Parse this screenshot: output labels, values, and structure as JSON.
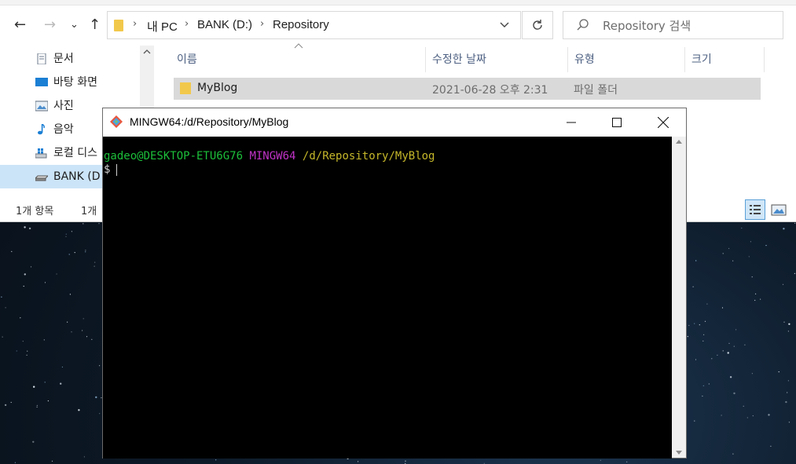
{
  "explorer": {
    "nav": {
      "back": "←",
      "forward": "→",
      "recent": "⌄",
      "up": "↑"
    },
    "breadcrumbs": [
      "내 PC",
      "BANK (D:)",
      "Repository"
    ],
    "search_placeholder": "Repository 검색",
    "sidebar": {
      "items": [
        {
          "label": "문서",
          "icon": "documents-icon"
        },
        {
          "label": "바탕 화면",
          "icon": "desktop-icon"
        },
        {
          "label": "사진",
          "icon": "pictures-icon"
        },
        {
          "label": "음악",
          "icon": "music-icon"
        },
        {
          "label": "로컬 디스",
          "icon": "local-disk-icon"
        },
        {
          "label": "BANK (D",
          "icon": "drive-icon"
        }
      ]
    },
    "columns": [
      "이름",
      "수정한 날짜",
      "유형",
      "크기"
    ],
    "files": [
      {
        "name": "MyBlog",
        "modified": "2021-06-28 오후 2:31",
        "type": "파일 폴더",
        "size": ""
      }
    ],
    "status": {
      "count": "1개 항목",
      "selected": "1개"
    }
  },
  "terminal": {
    "title": "MINGW64:/d/Repository/MyBlog",
    "prompt_user": "gadeo@DESKTOP-ETU6G76",
    "prompt_system": "MINGW64",
    "prompt_path": "/d/Repository/MyBlog",
    "prompt_symbol": "$",
    "colors": {
      "user": "#1cbf3a",
      "system": "#c033c8",
      "path": "#c5b72a"
    }
  }
}
